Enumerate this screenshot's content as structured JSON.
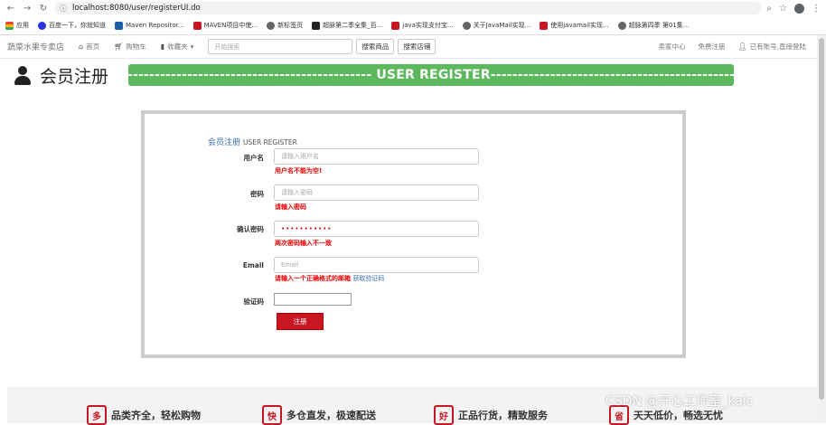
{
  "browser": {
    "url": "localhost:8080/user/registerUI.do",
    "bookmarks": [
      {
        "label": "应用",
        "icon": "apps-icon"
      },
      {
        "label": "百度一下，你就知道",
        "icon": "baidu-icon"
      },
      {
        "label": "Maven Repositor...",
        "icon": "maven-icon"
      },
      {
        "label": "MAVEN项目中使...",
        "icon": "csdn-icon"
      },
      {
        "label": "新标签页",
        "icon": "globe-icon"
      },
      {
        "label": "超脉第二季全集_百...",
        "icon": "ticket-icon"
      },
      {
        "label": "java实现支付宝...",
        "icon": "csdn-icon"
      },
      {
        "label": "关于JavaMail实现...",
        "icon": "globe-icon"
      },
      {
        "label": "使用javamail实现...",
        "icon": "csdn-icon"
      },
      {
        "label": "超脉第四季 第01集...",
        "icon": "globe-icon"
      }
    ]
  },
  "site": {
    "brand": "蔬菜水果专卖店",
    "nav": [
      {
        "label": "首页",
        "icon": "home-icon"
      },
      {
        "label": "购物车",
        "icon": "cart-icon"
      },
      {
        "label": "收藏夹",
        "icon": "bookmark-icon"
      }
    ],
    "search_placeholder": "开始搜索",
    "search_goods": "搜索商品",
    "search_shop": "搜索店铺",
    "seller_center": "卖家中心",
    "free_register": "免费注册",
    "login_prompt": "已有账号,直接登陆"
  },
  "title": {
    "text": "会员注册",
    "banner": "-----------------------------------------------------------------------  USER REGISTER-----------------------------------------------------------------------"
  },
  "form": {
    "heading_zh": "会员注册",
    "heading_en": "USER REGISTER",
    "username_label": "用户名",
    "username_placeholder": "请输入用户名",
    "username_error": "用户名不能为空!",
    "password_label": "密码",
    "password_placeholder": "请输入密码",
    "password_error": "请输入密码",
    "confirm_label": "确认密码",
    "confirm_value": "•••••••••••",
    "confirm_error": "两次密码输入不一致",
    "email_label": "Email",
    "email_placeholder": "Email",
    "email_error": "请输入一个正确格式的邮箱",
    "email_link": "获取验证码",
    "captcha_label": "验证码",
    "submit": "注册"
  },
  "services": [
    {
      "badge": "多",
      "text": "品类齐全，轻松购物"
    },
    {
      "badge": "快",
      "text": "多仓直发，极速配送"
    },
    {
      "badge": "好",
      "text": "正品行货，精致服务"
    },
    {
      "badge": "省",
      "text": "天天低价，畅选无忧"
    }
  ],
  "watermark": "CSDN @开心工作室_kaic"
}
